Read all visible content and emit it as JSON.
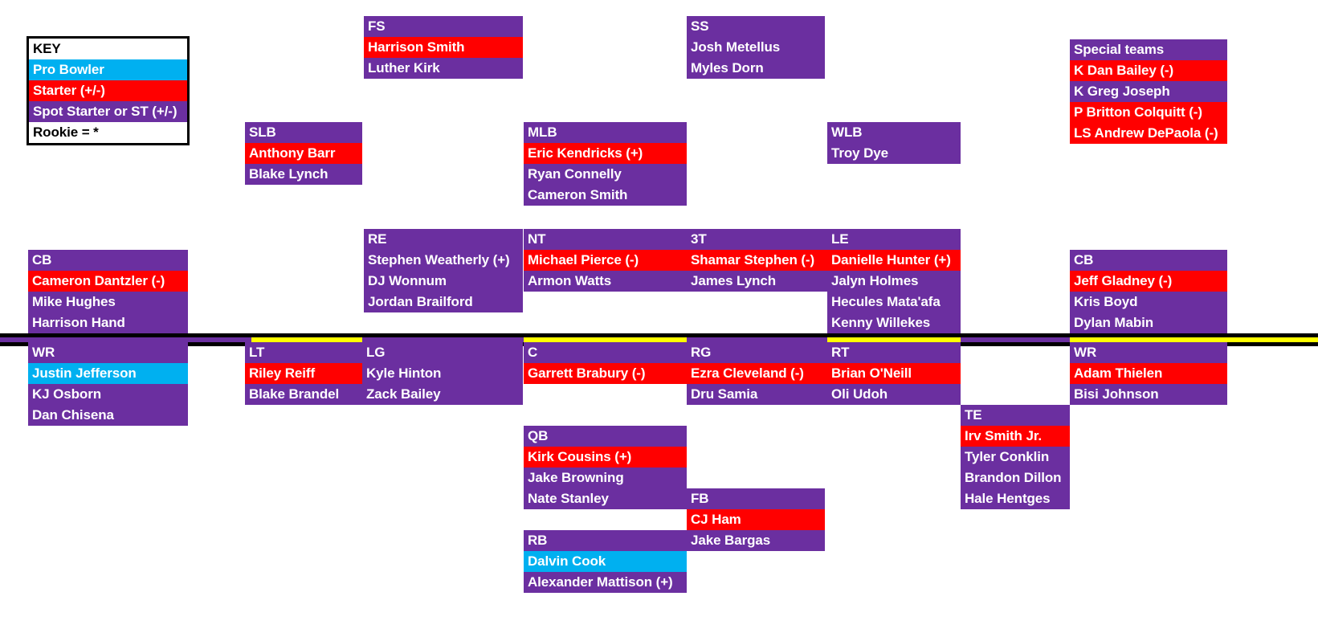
{
  "key": {
    "title": "KEY",
    "rows": [
      {
        "label": "Pro Bowler",
        "color": "#00B0F0"
      },
      {
        "label": "Starter (+/-)",
        "color": "#FF0000"
      },
      {
        "label": "Spot Starter or ST (+/-)",
        "color": "#6B2FA0"
      },
      {
        "label": "Rookie = *",
        "color": "#FFFFFF"
      }
    ]
  },
  "colors": {
    "pro_bowler": "#00B0F0",
    "starter": "#FF0000",
    "spot_starter": "#6B2FA0",
    "line_of_scrimmage": "#000000",
    "line_marker": "#FFFF00"
  },
  "groups": {
    "fs": {
      "header": "FS",
      "players": [
        {
          "name": "Harrison Smith",
          "tier": "starter"
        },
        {
          "name": "Luther Kirk",
          "tier": "spot"
        }
      ]
    },
    "ss": {
      "header": "SS",
      "players": [
        {
          "name": "Josh Metellus",
          "tier": "spot"
        },
        {
          "name": "Myles Dorn",
          "tier": "spot"
        }
      ]
    },
    "special_teams": {
      "header": "Special teams",
      "players": [
        {
          "name": "K Dan Bailey (-)",
          "tier": "starter"
        },
        {
          "name": "K Greg Joseph",
          "tier": "spot"
        },
        {
          "name": "P Britton Colquitt (-)",
          "tier": "starter"
        },
        {
          "name": "LS Andrew DePaola (-)",
          "tier": "starter"
        }
      ]
    },
    "slb": {
      "header": "SLB",
      "players": [
        {
          "name": "Anthony Barr",
          "tier": "starter"
        },
        {
          "name": "Blake Lynch",
          "tier": "spot"
        }
      ]
    },
    "mlb": {
      "header": "MLB",
      "players": [
        {
          "name": "Eric Kendricks (+)",
          "tier": "starter"
        },
        {
          "name": "Ryan Connelly",
          "tier": "spot"
        },
        {
          "name": "Cameron Smith",
          "tier": "spot"
        }
      ]
    },
    "wlb": {
      "header": "WLB",
      "players": [
        {
          "name": "Troy Dye",
          "tier": "spot"
        }
      ]
    },
    "re": {
      "header": "RE",
      "players": [
        {
          "name": "Stephen Weatherly (+)",
          "tier": "spot"
        },
        {
          "name": "DJ Wonnum",
          "tier": "spot"
        },
        {
          "name": "Jordan Brailford",
          "tier": "spot"
        }
      ]
    },
    "nt": {
      "header": "NT",
      "players": [
        {
          "name": "Michael Pierce (-)",
          "tier": "starter"
        },
        {
          "name": "Armon Watts",
          "tier": "spot"
        }
      ]
    },
    "3t": {
      "header": "3T",
      "players": [
        {
          "name": "Shamar Stephen (-)",
          "tier": "starter"
        },
        {
          "name": "James Lynch",
          "tier": "spot"
        }
      ]
    },
    "le": {
      "header": "LE",
      "players": [
        {
          "name": "Danielle Hunter (+)",
          "tier": "starter"
        },
        {
          "name": "Jalyn Holmes",
          "tier": "spot"
        },
        {
          "name": "Hecules Mata'afa",
          "tier": "spot"
        },
        {
          "name": "Kenny Willekes",
          "tier": "spot"
        }
      ]
    },
    "cb_left": {
      "header": "CB",
      "players": [
        {
          "name": "Cameron Dantzler (-)",
          "tier": "starter"
        },
        {
          "name": "Mike Hughes",
          "tier": "spot"
        },
        {
          "name": "Harrison Hand",
          "tier": "spot"
        }
      ]
    },
    "cb_right": {
      "header": "CB",
      "players": [
        {
          "name": "Jeff Gladney (-)",
          "tier": "starter"
        },
        {
          "name": "Kris Boyd",
          "tier": "spot"
        },
        {
          "name": "Dylan Mabin",
          "tier": "spot"
        }
      ]
    },
    "wr_left": {
      "header": "WR",
      "players": [
        {
          "name": "Justin Jefferson",
          "tier": "pro"
        },
        {
          "name": "KJ Osborn",
          "tier": "spot"
        },
        {
          "name": "Dan Chisena",
          "tier": "spot"
        }
      ]
    },
    "wr_right": {
      "header": "WR",
      "players": [
        {
          "name": "Adam Thielen",
          "tier": "starter"
        },
        {
          "name": "Bisi Johnson",
          "tier": "spot"
        }
      ]
    },
    "lt": {
      "header": "LT",
      "players": [
        {
          "name": "Riley Reiff",
          "tier": "starter"
        },
        {
          "name": "Blake Brandel",
          "tier": "spot"
        }
      ]
    },
    "lg": {
      "header": "LG",
      "players": [
        {
          "name": "Kyle Hinton",
          "tier": "spot"
        },
        {
          "name": "Zack Bailey",
          "tier": "spot"
        }
      ]
    },
    "c": {
      "header": "C",
      "players": [
        {
          "name": "Garrett Brabury (-)",
          "tier": "starter"
        }
      ]
    },
    "rg": {
      "header": "RG",
      "players": [
        {
          "name": "Ezra Cleveland (-)",
          "tier": "starter"
        },
        {
          "name": "Dru Samia",
          "tier": "spot"
        }
      ]
    },
    "rt": {
      "header": "RT",
      "players": [
        {
          "name": "Brian O'Neill",
          "tier": "starter"
        },
        {
          "name": "Oli Udoh",
          "tier": "spot"
        }
      ]
    },
    "te": {
      "header": "TE",
      "players": [
        {
          "name": "Irv Smith Jr.",
          "tier": "starter"
        },
        {
          "name": "Tyler Conklin",
          "tier": "spot"
        },
        {
          "name": "Brandon Dillon",
          "tier": "spot"
        },
        {
          "name": "Hale Hentges",
          "tier": "spot"
        }
      ]
    },
    "qb": {
      "header": "QB",
      "players": [
        {
          "name": "Kirk Cousins (+)",
          "tier": "starter"
        },
        {
          "name": "Jake Browning",
          "tier": "spot"
        },
        {
          "name": "Nate Stanley",
          "tier": "spot"
        }
      ]
    },
    "fb": {
      "header": "FB",
      "players": [
        {
          "name": "CJ Ham",
          "tier": "starter"
        },
        {
          "name": "Jake Bargas",
          "tier": "spot"
        }
      ]
    },
    "rb": {
      "header": "RB",
      "players": [
        {
          "name": "Dalvin Cook",
          "tier": "pro"
        },
        {
          "name": "Alexander Mattison (+)",
          "tier": "spot"
        }
      ]
    }
  }
}
